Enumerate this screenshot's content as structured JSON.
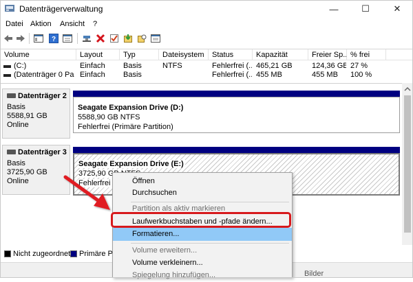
{
  "window": {
    "title": "Datenträgerverwaltung",
    "minimize_glyph": "—",
    "maximize_glyph": "☐",
    "close_glyph": "✕"
  },
  "menu": [
    "Datei",
    "Aktion",
    "Ansicht",
    "?"
  ],
  "toolbar": [
    "back-icon",
    "forward-icon",
    "console-tree-icon",
    "help-icon",
    "properties-icon",
    "connect-icon",
    "delete-icon",
    "check-icon",
    "import-icon",
    "rescan-icon",
    "settings-icon"
  ],
  "listview": {
    "columns": [
      "Volume",
      "Layout",
      "Typ",
      "Dateisystem",
      "Status",
      "Kapazität",
      "Freier Sp...",
      "% frei"
    ],
    "rows": [
      [
        "(C:)",
        "Einfach",
        "Basis",
        "NTFS",
        "Fehlerfrei (...",
        "465,21 GB",
        "124,36 GB",
        "27 %"
      ],
      [
        "(Datenträger 0 Par...",
        "Einfach",
        "Basis",
        "",
        "Fehlerfrei (...",
        "455 MB",
        "455 MB",
        "100 %"
      ]
    ]
  },
  "disks": [
    {
      "name": "Datenträger 2",
      "type": "Basis",
      "size": "5588,91 GB",
      "status": "Online",
      "partition": {
        "title": "Seagate Expansion Drive  (D:)",
        "size_fs": "5588,90 GB NTFS",
        "health": "Fehlerfrei (Primäre Partition)"
      }
    },
    {
      "name": "Datenträger 3",
      "type": "Basis",
      "size": "3725,90 GB",
      "status": "Online",
      "partition": {
        "title": "Seagate Expansion Drive  (E:)",
        "size_fs": "3725,90 GB NTFS",
        "health": "Fehlerfrei (P"
      }
    }
  ],
  "legend": [
    {
      "label": "Nicht zugeordnet",
      "color": "#000000"
    },
    {
      "label": "Primäre Pa",
      "color": "#000080"
    }
  ],
  "status_partial": "Bilder",
  "context_menu": {
    "items": [
      {
        "label": "Öffnen",
        "enabled": true
      },
      {
        "label": "Durchsuchen",
        "enabled": true
      },
      {
        "label": "Partition als aktiv markieren",
        "enabled": false
      },
      {
        "label": "Laufwerkbuchstaben und -pfade ändern...",
        "enabled": true
      },
      {
        "label": "Formatieren...",
        "enabled": true,
        "highlighted": true
      },
      {
        "label": "Volume erweitern...",
        "enabled": false
      },
      {
        "label": "Volume verkleinern...",
        "enabled": true
      },
      {
        "label": "Spiegelung hinzufügen...",
        "enabled": false
      }
    ]
  },
  "colors": {
    "partition_bar": "#000080",
    "annotation_red": "#d7191c",
    "menu_highlight": "#91c9f7"
  }
}
